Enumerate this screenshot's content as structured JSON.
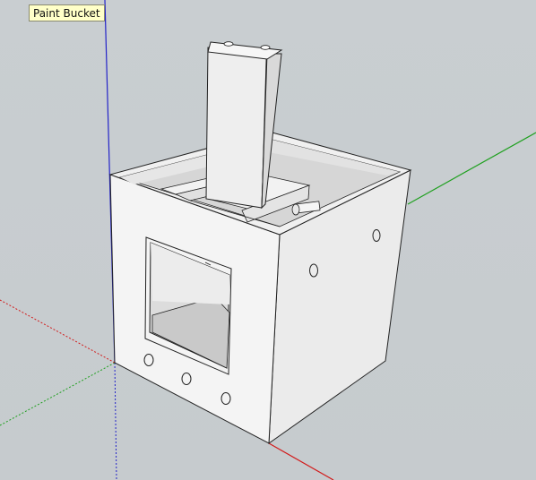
{
  "tooltip": {
    "text": "Paint Bucket",
    "icon": "paint-bucket-icon"
  },
  "axes_colors": {
    "red": "#d21a1a",
    "green": "#20a020",
    "blue": "#2020c8"
  },
  "model": {
    "face_color": "#f4f4f4",
    "shadow_color": "#c9c9c9",
    "edge_color": "#222222"
  }
}
